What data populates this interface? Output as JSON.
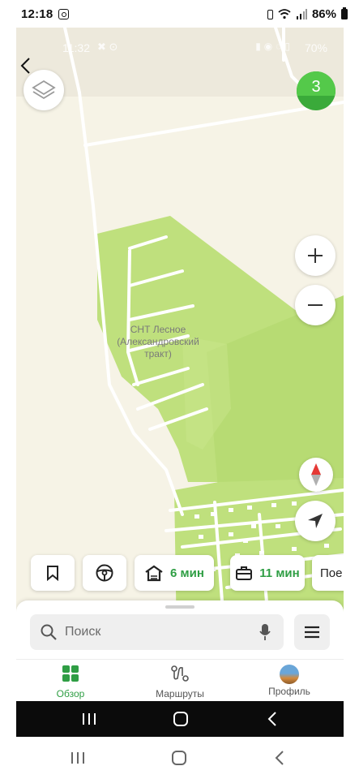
{
  "status_bar": {
    "time": "12:18",
    "battery": "86%"
  },
  "inner_status_bar": {
    "time": "11:32",
    "battery": "70%"
  },
  "map": {
    "label_line1": "СНТ Лесное",
    "label_line2": "(Александровский",
    "label_line3": "тракт)"
  },
  "avatar": {
    "badge": "3"
  },
  "chips": {
    "home_time": "6 мин",
    "work_time": "11 мин",
    "partial": "Пое"
  },
  "search": {
    "placeholder": "Поиск"
  },
  "tabs": [
    {
      "label": "Обзор",
      "active": true
    },
    {
      "label": "Маршруты",
      "active": false
    },
    {
      "label": "Профиль",
      "active": false
    }
  ],
  "colors": {
    "accent": "#2f9e44",
    "map_background": "#f6f3e6",
    "forest": "#bfe07d"
  },
  "icons": {
    "back": "back-arrow-icon",
    "layers": "layers-icon",
    "zoom_in": "plus-icon",
    "zoom_out": "minus-icon",
    "compass": "compass-icon",
    "locate": "navigation-arrow-icon",
    "bookmark": "bookmark-icon",
    "wheel": "steering-wheel-icon",
    "home": "home-icon",
    "work": "briefcase-icon",
    "search": "search-icon",
    "mic": "microphone-icon",
    "menu": "hamburger-menu-icon"
  }
}
